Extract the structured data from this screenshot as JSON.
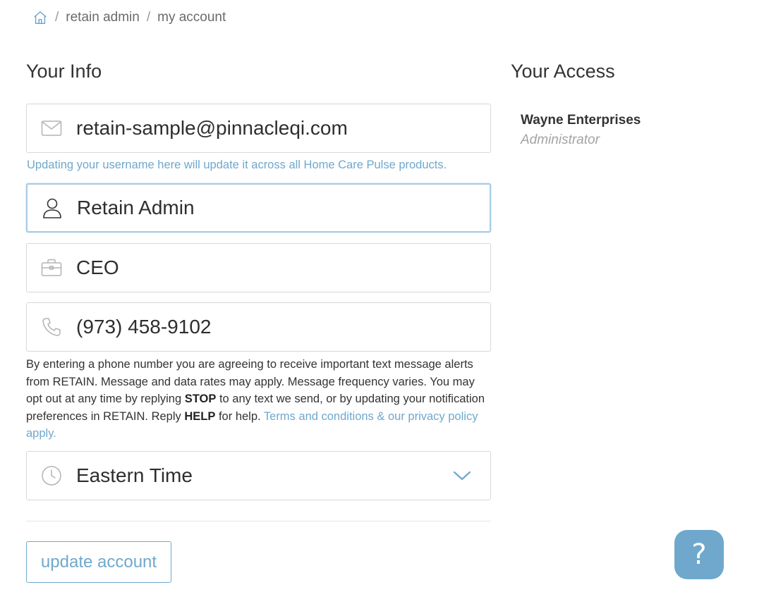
{
  "breadcrumb": {
    "home_icon": "home-icon",
    "separator": "/",
    "items": [
      "retain admin",
      "my account"
    ]
  },
  "your_info": {
    "title": "Your Info",
    "email": {
      "icon": "envelope-icon",
      "value": "retain-sample@pinnacleqi.com"
    },
    "email_hint": "Updating your username here will update it across all Home Care Pulse products.",
    "name": {
      "icon": "user-icon",
      "value": "Retain Admin"
    },
    "job_title": {
      "icon": "briefcase-icon",
      "value": "CEO"
    },
    "phone": {
      "icon": "phone-icon",
      "value": "(973) 458-9102"
    },
    "disclaimer": {
      "part1": "By entering a phone number you are agreeing to receive important text message alerts from RETAIN. Message and data rates may apply. Message frequency varies. You may opt out at any time by replying ",
      "stop": "STOP",
      "part2": " to any text we send, or by updating your notification preferences in RETAIN. Reply ",
      "help": "HELP",
      "part3": " for help. ",
      "link": "Terms and conditions & our privacy policy apply."
    },
    "timezone": {
      "icon": "clock-icon",
      "value": "Eastern Time",
      "dropdown_icon": "chevron-down-icon"
    },
    "update_button": "update account"
  },
  "your_access": {
    "title": "Your Access",
    "organization": "Wayne Enterprises",
    "role": "Administrator"
  },
  "help_button": {
    "label": "?",
    "icon": "question-icon"
  },
  "colors": {
    "accent": "#6fa8cc",
    "border": "#d8d8d8",
    "focus_border": "#a7cbe3",
    "text": "#333333",
    "muted": "#a3a3a3"
  }
}
